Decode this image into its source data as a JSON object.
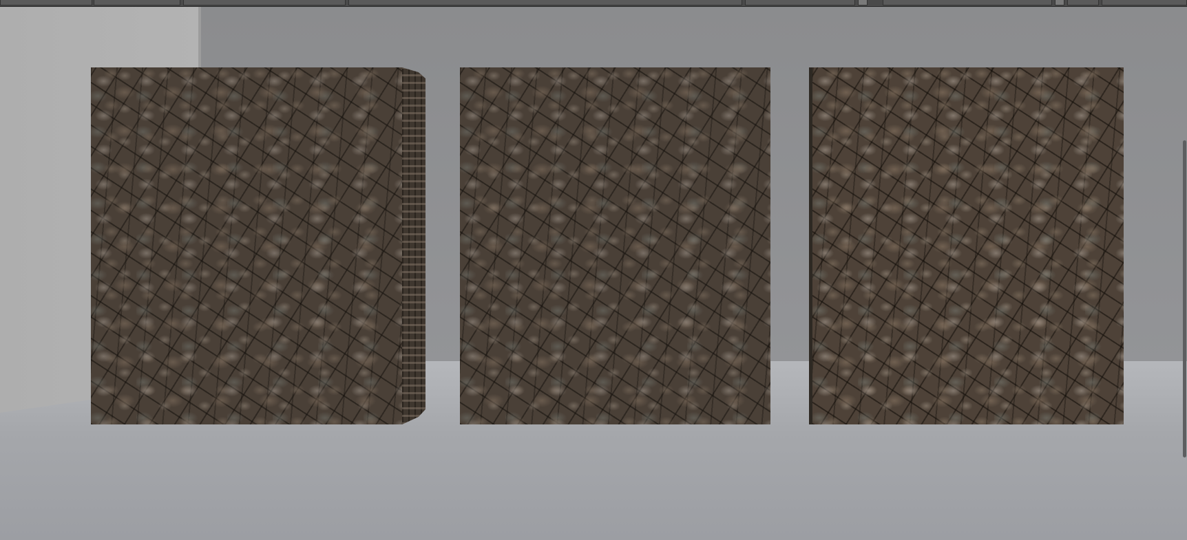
{
  "toolbar": {
    "fields": [
      {
        "name": "toolbar-field-1"
      },
      {
        "name": "toolbar-field-2"
      },
      {
        "name": "toolbar-field-3"
      },
      {
        "name": "toolbar-field-4"
      },
      {
        "name": "toolbar-field-5"
      }
    ],
    "icons": [
      "view-icon",
      "layout-icon"
    ]
  },
  "viewport": {
    "scene_objects": [
      "stone-textured-cube-left",
      "stone-textured-cube-center",
      "stone-textured-cube-right"
    ],
    "texture": "cobblestone"
  },
  "colors": {
    "background_wall": "#8b8c8e",
    "floor": "#a5a7ab",
    "side_wall": "#b0b0b0",
    "stone_base": "#4a4037"
  },
  "scrollbar": {
    "orientation": "vertical"
  }
}
